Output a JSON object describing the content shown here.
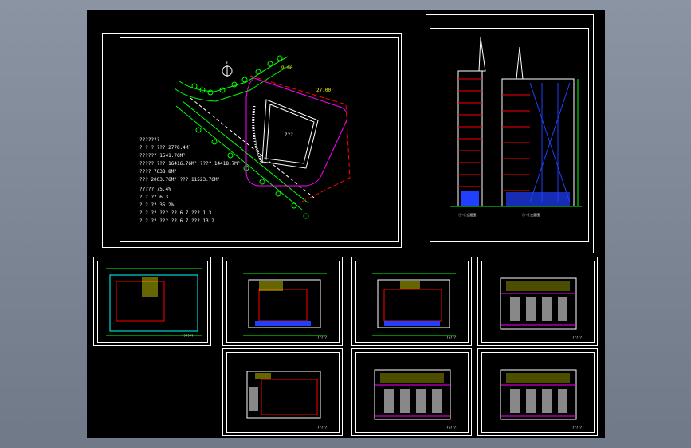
{
  "colors": {
    "background": "#7a8492",
    "model_space": "#000000",
    "frame": "#ffffff",
    "green": "#00ff00",
    "magenta": "#ff00ff",
    "cyan": "#00ffff",
    "red": "#ff0000",
    "yellow": "#ffff00",
    "blue": "#2040ff"
  },
  "site_plan": {
    "north_label": "N",
    "building_label": "??? ",
    "notes": [
      "???????",
      "? ? ? ??? 2778.4M²",
      "?????? 1541.76M²",
      "?????   ??? 16416.76M²  ???? 14418.7M²",
      "                  ???? 7638.8M²",
      "       ??? 2003.76M²  ??? 11523.76M²",
      "?????  75.4%",
      "? ? ?? 6.3",
      "? ? ?? 35.2%",
      "? ? ?? ??? ?? 6.7 ??? 1.3",
      "? ? ?? ??? ?? 6.7 ??? 13.2"
    ]
  },
  "elevations": {
    "label_left": "①-⑧立面图",
    "label_right": "⑦-①立面图"
  },
  "floor_plans": [
    {
      "id": "plan-1",
      "caption": "??????"
    },
    {
      "id": "plan-2",
      "caption": "??????"
    },
    {
      "id": "plan-3",
      "caption": "??????"
    },
    {
      "id": "plan-4",
      "caption": "??????"
    },
    {
      "id": "plan-5",
      "caption": "??????"
    },
    {
      "id": "plan-6",
      "caption": "??????"
    },
    {
      "id": "plan-7",
      "caption": "??????"
    }
  ]
}
